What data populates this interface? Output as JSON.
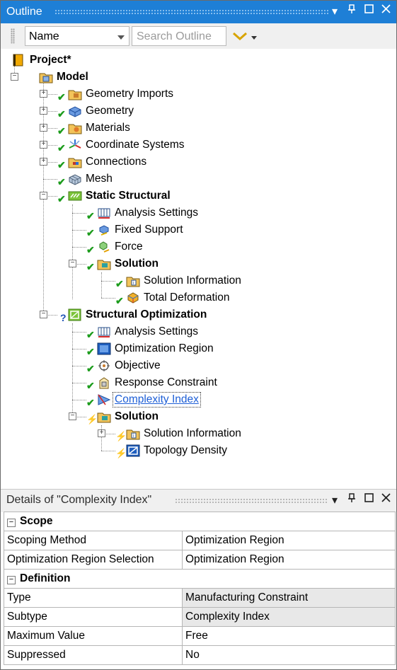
{
  "outline": {
    "title": "Outline",
    "window_controls": [
      "▾",
      "⊥",
      "□",
      "✕"
    ]
  },
  "toolbar": {
    "name_combo": "Name",
    "search_placeholder": "Search Outline"
  },
  "tree": {
    "project": "Project*",
    "model": "Model",
    "geometry_imports": "Geometry Imports",
    "geometry": "Geometry",
    "materials": "Materials",
    "coordinate_systems": "Coordinate Systems",
    "connections": "Connections",
    "mesh": "Mesh",
    "static_structural": "Static Structural",
    "ss_analysis_settings": "Analysis Settings",
    "fixed_support": "Fixed Support",
    "force": "Force",
    "ss_solution": "Solution",
    "ss_solution_information": "Solution Information",
    "total_deformation": "Total Deformation",
    "structural_optimization": "Structural Optimization",
    "so_analysis_settings": "Analysis Settings",
    "optimization_region": "Optimization Region",
    "objective": "Objective",
    "response_constraint": "Response Constraint",
    "complexity_index": "Complexity Index",
    "so_solution": "Solution",
    "so_solution_information": "Solution Information",
    "topology_density": "Topology Density"
  },
  "details": {
    "title": "Details of \"Complexity Index\"",
    "groups": {
      "scope": "Scope",
      "definition": "Definition"
    },
    "rows": {
      "scoping_method_k": "Scoping Method",
      "scoping_method_v": "Optimization Region",
      "opt_region_sel_k": "Optimization Region Selection",
      "opt_region_sel_v": "Optimization Region",
      "type_k": "Type",
      "type_v": "Manufacturing Constraint",
      "subtype_k": "Subtype",
      "subtype_v": "Complexity Index",
      "max_value_k": "Maximum Value",
      "max_value_v": "Free",
      "suppressed_k": "Suppressed",
      "suppressed_v": "No"
    }
  },
  "colors": {
    "title_bar": "#1e7fd6",
    "check": "#1d9c1d",
    "lightning": "#e3b400",
    "selection_text": "#1e5fd6"
  }
}
